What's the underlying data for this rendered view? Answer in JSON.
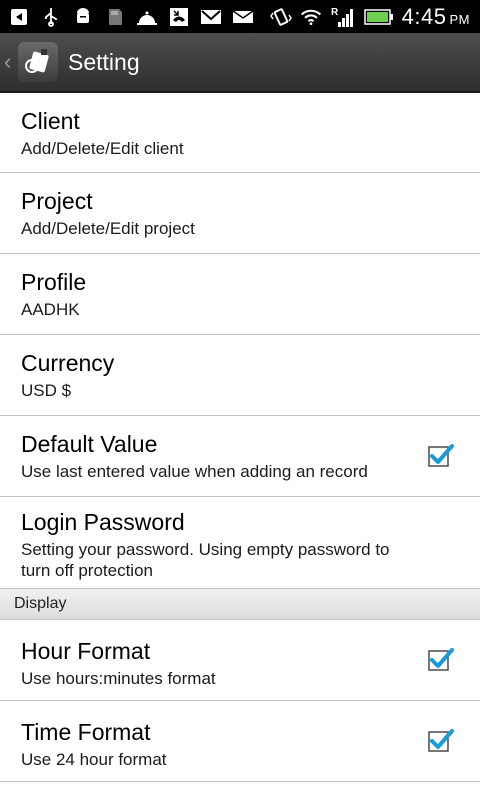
{
  "status_bar": {
    "time": "4:45",
    "ampm": "PM",
    "icons": [
      "back-notification-icon",
      "usb-icon",
      "android-debug-icon",
      "sd-card-icon",
      "bell-icon",
      "missed-call-icon",
      "gmail-icon",
      "email-icon",
      "vibrate-icon",
      "wifi-icon",
      "signal-icon",
      "battery-icon"
    ],
    "battery_color": "#6bd14a"
  },
  "action_bar": {
    "title": "Setting",
    "icon": "app-icon"
  },
  "settings": [
    {
      "title": "Client",
      "subtitle": "Add/Delete/Edit client"
    },
    {
      "title": "Project",
      "subtitle": "Add/Delete/Edit project"
    },
    {
      "title": "Profile",
      "subtitle": "AADHK"
    },
    {
      "title": "Currency",
      "subtitle": "USD $"
    },
    {
      "title": "Default Value",
      "subtitle": "Use last entered value when adding an record",
      "checked": true
    },
    {
      "title": "Login Password",
      "subtitle": "Setting your password. Using empty password to turn off protection"
    }
  ],
  "display_section": {
    "header": "Display",
    "items": [
      {
        "title": "Hour Format",
        "subtitle": "Use hours:minutes format",
        "checked": true
      },
      {
        "title": "Time Format",
        "subtitle": "Use 24 hour format",
        "checked": true
      }
    ]
  },
  "colors": {
    "check_blue": "#1a9bd7",
    "divider": "#c4c4c4"
  }
}
